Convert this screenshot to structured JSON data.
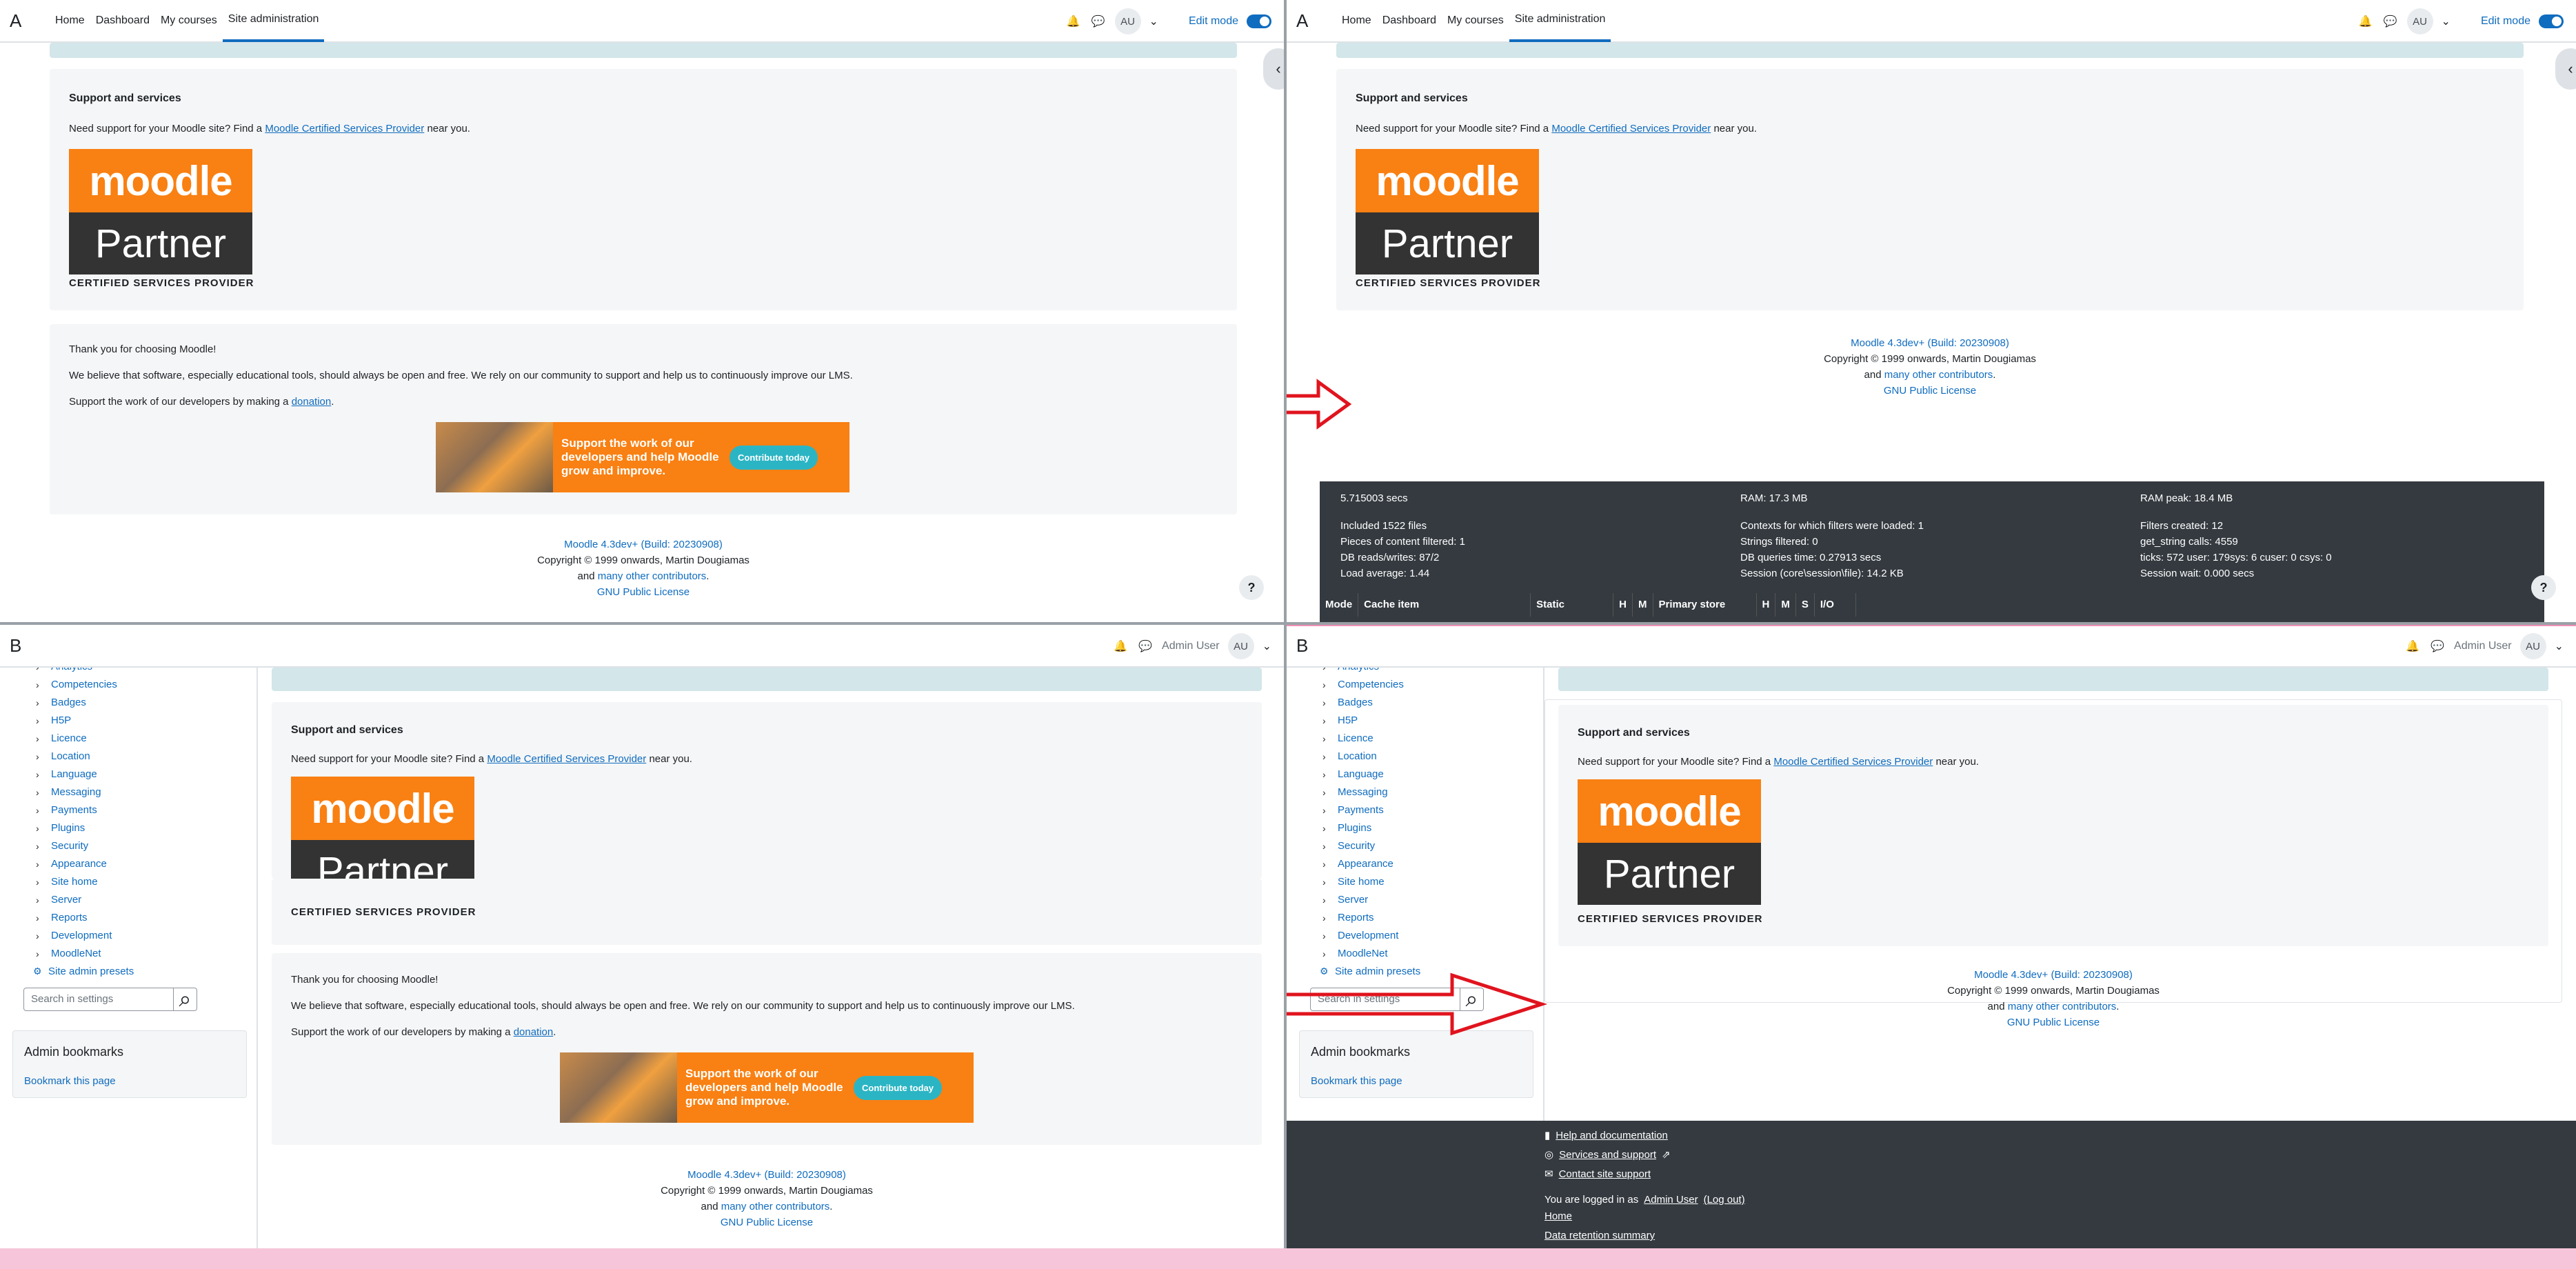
{
  "panels": {
    "a": {
      "label": "A"
    },
    "b": {
      "label": "A"
    },
    "c": {
      "label": "B"
    },
    "d": {
      "label": "B"
    }
  },
  "nav": {
    "links": [
      "Home",
      "Dashboard",
      "My courses",
      "Site administration"
    ],
    "edit_mode": "Edit mode",
    "avatar": "AU",
    "user_name": "Admin User"
  },
  "support": {
    "title": "Support and services",
    "text_before": "Need support for your Moodle site? Find a",
    "link": "Moodle Certified Services Provider",
    "text_after": "near you.",
    "partner_top": "moodle",
    "partner_bottom": "Partner",
    "partner_caption": "CERTIFIED SERVICES PROVIDER"
  },
  "thanks": {
    "line1": "Thank you for choosing Moodle!",
    "line2": "We believe that software, especially educational tools, should always be open and free. We rely on our community to support and help us to continuously improve our LMS.",
    "line3_before": "Support the work of our developers by making a",
    "line3_link": "donation",
    "line3_after": ".",
    "banner_text": "Support the work of our developers and help Moodle grow and improve.",
    "banner_button": "Contribute today"
  },
  "footer": {
    "version": "Moodle 4.3dev+ (Build: 20230908)",
    "copyright": "Copyright © 1999 onwards, Martin Dougiamas",
    "and": "and",
    "contributors": "many other contributors",
    "period": ".",
    "license": "GNU Public License"
  },
  "perf": {
    "time": "5.715003 secs",
    "ram": "RAM: 17.3 MB",
    "ram_peak": "RAM peak: 18.4 MB",
    "included": "Included 1522 files",
    "contexts": "Contexts for which filters were loaded: 1",
    "filters_created": "Filters created: 12",
    "pieces": "Pieces of content filtered: 1",
    "strings": "Strings filtered: 0",
    "get_string": "get_string calls: 4559",
    "db_rw": "DB reads/writes: 87/2",
    "db_time": "DB queries time: 0.27913 secs",
    "ticks": "ticks: 572 user: 179sys: 6 cuser: 0 csys: 0",
    "load": "Load average: 1.44",
    "session": "Session (core\\session\\file): 14.2 KB",
    "session_wait": "Session wait: 0.000 secs",
    "table_headers": [
      "Mode",
      "Cache item",
      "Static",
      "H",
      "M",
      "Primary store",
      "H",
      "M",
      "S",
      "I/O"
    ]
  },
  "sidebar": {
    "items": [
      "Analytics",
      "Competencies",
      "Badges",
      "H5P",
      "Licence",
      "Location",
      "Language",
      "Messaging",
      "Payments",
      "Plugins",
      "Security",
      "Appearance",
      "Site home",
      "Server",
      "Reports",
      "Development",
      "MoodleNet"
    ],
    "presets": "Site admin presets",
    "search_placeholder": "Search in settings",
    "bookmarks_title": "Admin bookmarks",
    "bookmark_link": "Bookmark this page"
  },
  "dark_footer": {
    "help": "Help and documentation",
    "services": "Services and support",
    "contact": "Contact site support",
    "logged_before": "You are logged in as",
    "logged_user": "Admin User",
    "logout": "(Log out)",
    "home": "Home",
    "retention": "Data retention summary"
  },
  "colors": {
    "accent": "#0f6cbf",
    "moodle_orange": "#f98012",
    "arrow_red": "#e0141e"
  }
}
